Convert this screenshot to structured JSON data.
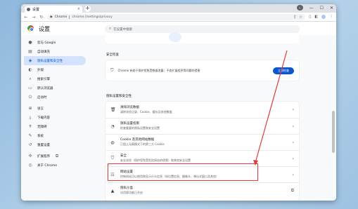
{
  "browser": {
    "tab_title": "设置",
    "tab_close": "×",
    "new_tab": "+",
    "url_chip": "Chrome",
    "url": "chrome://settings/privacy"
  },
  "settings": {
    "title": "设置",
    "search_placeholder": "在设置中搜索"
  },
  "sidebar": {
    "items": [
      {
        "label": "您与 Google",
        "icon": "person-icon"
      },
      {
        "label": "自动填充",
        "icon": "autofill-icon"
      },
      {
        "label": "隐私设置和安全性",
        "icon": "shield-icon",
        "active": true
      },
      {
        "label": "外观",
        "icon": "palette-icon"
      },
      {
        "label": "搜索引擎",
        "icon": "search-icon"
      },
      {
        "label": "默认浏览器",
        "icon": "browser-icon"
      },
      {
        "label": "启动时",
        "icon": "power-icon"
      },
      {
        "label": "语言",
        "icon": "globe-icon"
      },
      {
        "label": "下载内容",
        "icon": "download-icon"
      },
      {
        "label": "无障碍",
        "icon": "accessibility-icon"
      },
      {
        "label": "系统",
        "icon": "wrench-icon"
      },
      {
        "label": "重置设置",
        "icon": "reset-icon"
      },
      {
        "label": "扩展程序",
        "icon": "puzzle-icon"
      },
      {
        "label": "关于 Chrome",
        "icon": "chrome-icon"
      }
    ]
  },
  "safety_check": {
    "section_label": "安全检查",
    "text": "Chrome 有助于保护您免受数据泄露、不良扩展程序等问题的侵害",
    "button": "立即检查"
  },
  "privacy": {
    "section_label": "隐私设置和安全性",
    "rows": [
      {
        "title": "清除浏览数据",
        "desc": "清除浏览记录、Cookie、缓存及其他数据",
        "icon": "trash-icon",
        "trailing": "›"
      },
      {
        "title": "隐私设置指南",
        "desc": "检查重要的隐私设置和安全设置",
        "icon": "guide-icon",
        "trailing": "›"
      },
      {
        "title": "Cookie 及其他网站数据",
        "desc": "已阻止无痕模式下的第三方 Cookie",
        "icon": "cookie-icon",
        "trailing": "›"
      },
      {
        "title": "安全",
        "desc": "安全浏览（保护您免受危险网站的侵害）和其他安全设置",
        "icon": "shield-icon",
        "trailing": "›"
      },
      {
        "title": "网站设置",
        "desc": "控制网站可以使用和显示什么信息（如位置信息、摄像头、弹出式窗口及其他）",
        "icon": "sliders-icon",
        "trailing": "›"
      },
      {
        "title": "隐私沙盒",
        "desc": "试用版功能已开启",
        "icon": "flask-icon",
        "trailing": "⧉"
      }
    ]
  },
  "colors": {
    "accent": "#0b57d0",
    "highlight": "#e53935",
    "active_bg": "#d3e3fd"
  }
}
